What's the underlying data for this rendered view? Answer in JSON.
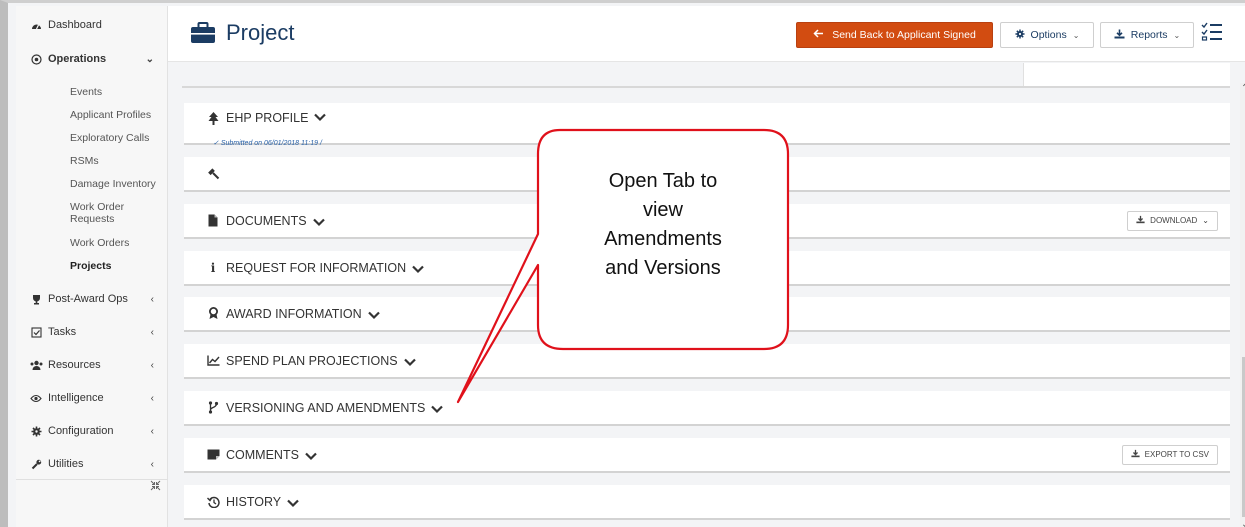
{
  "sidebar": {
    "items": [
      {
        "label": "Dashboard"
      },
      {
        "label": "Operations"
      },
      {
        "label": "Post-Award Ops"
      },
      {
        "label": "Tasks"
      },
      {
        "label": "Resources"
      },
      {
        "label": "Intelligence"
      },
      {
        "label": "Configuration"
      },
      {
        "label": "Utilities"
      }
    ],
    "sub_items": [
      {
        "label": "Events"
      },
      {
        "label": "Applicant Profiles"
      },
      {
        "label": "Exploratory Calls"
      },
      {
        "label": "RSMs"
      },
      {
        "label": "Damage Inventory"
      },
      {
        "label": "Work Order Requests"
      },
      {
        "label": "Work Orders"
      },
      {
        "label": "Projects"
      }
    ]
  },
  "header": {
    "title": "Project",
    "send_back_label": "Send Back to Applicant Signed",
    "options_label": "Options",
    "reports_label": "Reports"
  },
  "panels": [
    {
      "label": "EHP PROFILE",
      "sub": "Submitted on 06/01/2018 11:19 /"
    },
    {
      "label": ""
    },
    {
      "label": "DOCUMENTS",
      "button": "DOWNLOAD"
    },
    {
      "label": "REQUEST FOR INFORMATION"
    },
    {
      "label": "AWARD INFORMATION"
    },
    {
      "label": "SPEND PLAN PROJECTIONS"
    },
    {
      "label": "VERSIONING AND AMENDMENTS"
    },
    {
      "label": "COMMENTS",
      "button": "EXPORT TO CSV"
    },
    {
      "label": "HISTORY"
    }
  ],
  "callout": {
    "text_lines": [
      "Open Tab to",
      "view",
      "Amendments",
      "and Versions"
    ],
    "border_color": "#e0111b"
  },
  "colors": {
    "accent": "#d24c11",
    "brand": "#1b3c63",
    "link": "#2a62a8"
  }
}
